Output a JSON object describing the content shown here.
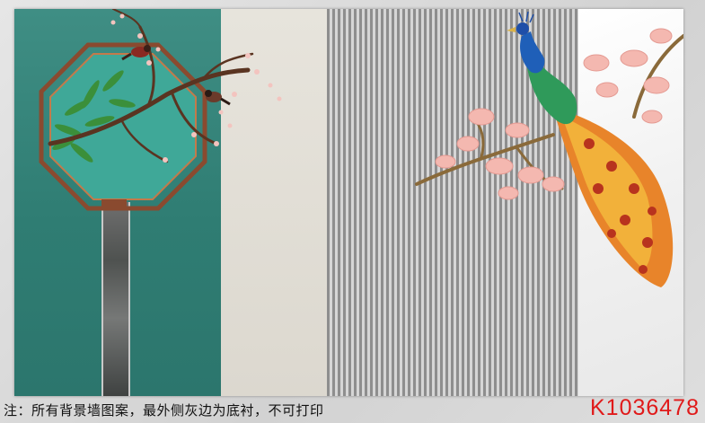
{
  "notice": "注：所有背景墙图案，最外侧灰边为底衬，不可打印",
  "product_code": "K1036478",
  "colors": {
    "teal_panel": "#2f7d73",
    "beige_panel": "#e2ded5",
    "stripe_dark": "#8e8e8e",
    "stripe_light": "#d6d6d6",
    "marble": "#f4f4f4",
    "peacock_blue": "#1f5fb8",
    "peacock_tail": "#e8842a",
    "blossom_pink": "#f4b8b0",
    "code_red": "#e01a1a"
  }
}
